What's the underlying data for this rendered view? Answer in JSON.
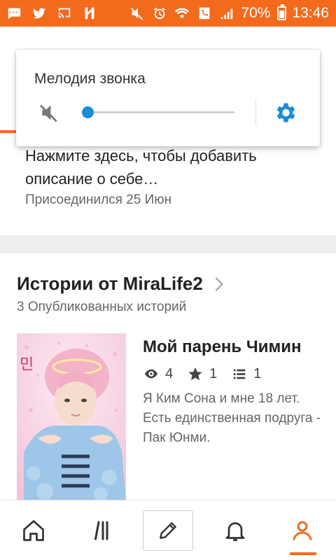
{
  "status_bar": {
    "battery_percent": "70%",
    "time": "13:46",
    "icons_left": [
      "messages-icon",
      "twitter-icon",
      "cast-icon",
      "app-icon"
    ],
    "icons_right": [
      "mute-icon",
      "alarm-icon",
      "wifi-icon",
      "phone-icon",
      "signal-icon",
      "battery-icon"
    ]
  },
  "volume_popup": {
    "title": "Мелодия звонка",
    "level_fraction": 0.0,
    "accent_color": "#1a8dd8"
  },
  "profile": {
    "bio_prompt": "Нажмите здесь, чтобы добавить описание о себе…",
    "joined": "Присоединился 25 Июн"
  },
  "stories": {
    "title": "Истории от MiraLife2",
    "count_label": "3 Опубликованных историй",
    "items": [
      {
        "title": "Мой парень Чимин",
        "views": "4",
        "votes": "1",
        "parts": "1",
        "description": "Я Ким Сона и мне 18 лет. Есть единственная подруга - Пак Юнми."
      }
    ]
  },
  "bottom_nav": {
    "items": [
      "home-icon",
      "library-icon",
      "write-icon",
      "notifications-icon",
      "profile-icon"
    ],
    "active": "profile-icon",
    "accent_color": "#f36a1d"
  }
}
